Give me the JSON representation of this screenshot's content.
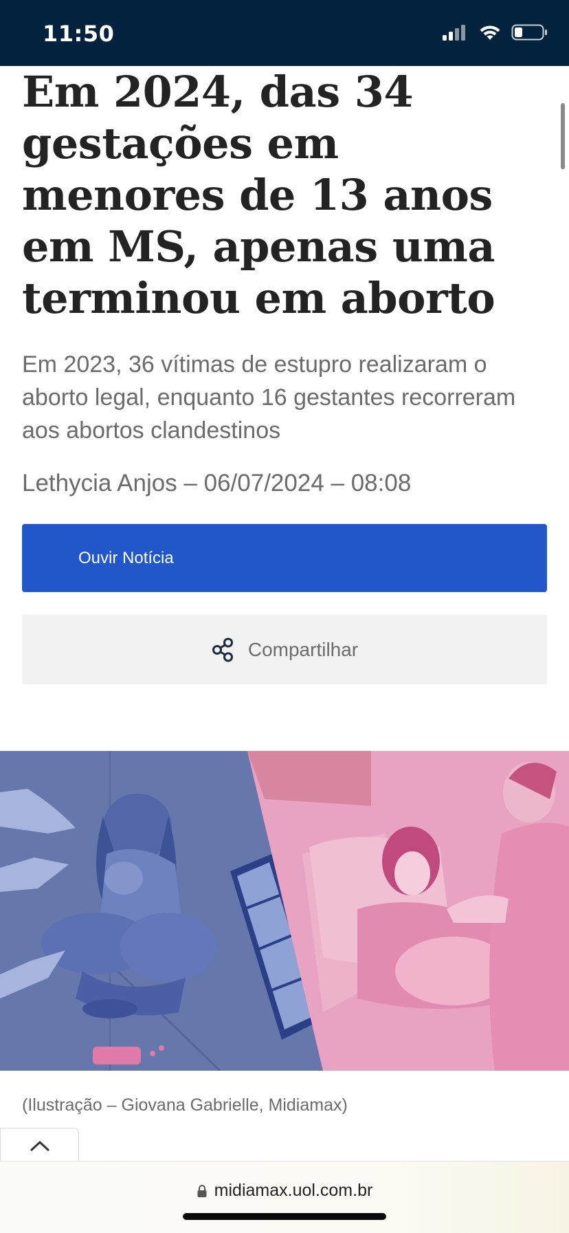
{
  "status_bar": {
    "time": "11:50",
    "bg_color": "#03223d",
    "icons": [
      "cellular-signal-icon",
      "wifi-icon",
      "battery-icon"
    ]
  },
  "article": {
    "headline": "Em 2024, das 34 gestações em menores de 13 anos em MS, apenas uma terminou em aborto",
    "subtitle": "Em 2023, 36 vítimas de estupro realizaram o aborto legal, enquanto 16 gestantes recorreram aos abortos clandestinos",
    "byline": "Lethycia Anjos – 06/07/2024 – 08:08",
    "image_caption": "(Ilustração – Giovana Gabrielle, Midiamax)"
  },
  "actions": {
    "listen_label": "Ouvir Notícia",
    "listen_color": "#2157c9",
    "share_label": "Compartilhar",
    "share_icon": "share-icon"
  },
  "browser": {
    "url": "midiamax.uol.com.br",
    "lock_icon": "lock-icon",
    "back_to_top_icon": "chevron-up-icon"
  }
}
